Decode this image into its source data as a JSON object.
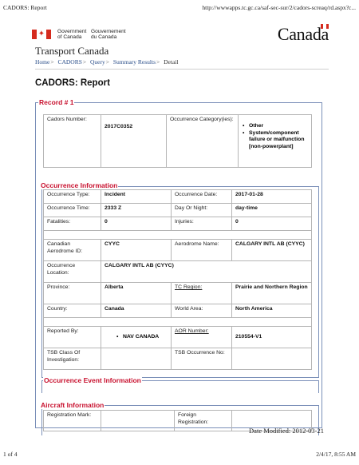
{
  "print_header": {
    "title": "CADORS: Report",
    "url": "http://wwwapps.tc.gc.ca/saf-sec-sur/2/cadors-screaq/rd.aspx?c..."
  },
  "print_footer": {
    "page": "1 of 4",
    "timestamp": "2/4/17, 8:55 AM"
  },
  "gov": {
    "en_line1": "Government",
    "en_line2": "of Canada",
    "fr_line1": "Gouvernement",
    "fr_line2": "du Canada",
    "wordmark": "Canada"
  },
  "site_title": "Transport Canada",
  "breadcrumb": [
    {
      "label": "Home",
      "sep": ">"
    },
    {
      "label": "CADORS",
      "sep": ">"
    },
    {
      "label": "Query",
      "sep": ">"
    },
    {
      "label": "Summary Results",
      "sep": ">"
    },
    {
      "label": "Detail",
      "sep": ""
    }
  ],
  "page_title": "CADORS: Report",
  "record": {
    "legend": "Record # 1",
    "cadors_number_label": "Cadors Number:",
    "cadors_number": "2017C0352",
    "category_label": "Occurrence Category(ies):",
    "categories": [
      "Other",
      "System/component failure or malfunction [non-powerplant]"
    ]
  },
  "occurrence": {
    "legend": "Occurrence Information",
    "type_label": "Occurrence Type:",
    "type": "Incident",
    "date_label": "Occurrence Date:",
    "date": "2017-01-28",
    "time_label": "Occurrence Time:",
    "time": "2333 Z",
    "day_night_label": "Day Or Night:",
    "day_night": "day-time",
    "fatalities_label": "Fatalities:",
    "fatalities": "0",
    "injuries_label": "Injuries:",
    "injuries": "0",
    "aerodrome_id_label": "Canadian Aerodrome ID:",
    "aerodrome_id": "CYYC",
    "aerodrome_name_label": "Aerodrome Name:",
    "aerodrome_name": "CALGARY INTL AB (CYYC)",
    "location_label": "Occurrence Location:",
    "location": "CALGARY INTL AB (CYYC)",
    "province_label": "Province:",
    "province": "Alberta",
    "tc_region_label": "TC Region:",
    "tc_region": "Prairie and Northern Region",
    "country_label": "Country:",
    "country": "Canada",
    "world_area_label": "World Area:",
    "world_area": "North America",
    "reported_by_label": "Reported By:",
    "reported_by": "NAV CANADA",
    "aor_label": "AOR Number:",
    "aor": "210554-V1",
    "tsb_class_label": "TSB Class Of Investigation:",
    "tsb_class": "",
    "tsb_occ_label": "TSB Occurrence No:",
    "tsb_occ": ""
  },
  "event": {
    "legend": "Occurrence Event Information"
  },
  "aircraft": {
    "legend": "Aircraft Information",
    "registration_label": "Registration Mark:",
    "registration": "",
    "foreign_label": "Foreign Registration:",
    "foreign": ""
  },
  "date_modified": "Date Modified:  2012-03-21"
}
